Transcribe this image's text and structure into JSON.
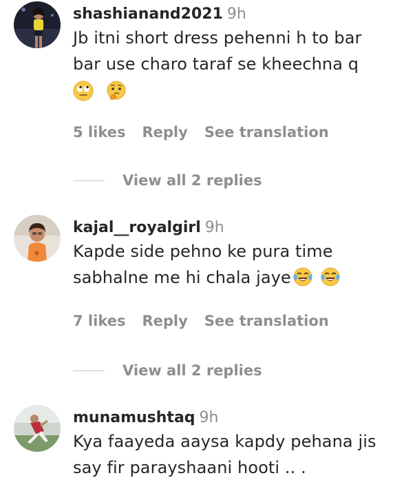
{
  "comments": [
    {
      "username": "shashianand2021",
      "time": "9h",
      "text_lines": [
        "Jb itni short dress pehenni h to bar",
        "bar use charo taraf se kheechna q"
      ],
      "emojis": [
        "face-with-rolling-eyes",
        "thinking-face"
      ],
      "likes": "5 likes",
      "reply": "Reply",
      "translate": "See translation",
      "view_replies": "View all 2 replies"
    },
    {
      "username": "kajal__royalgirl",
      "time": "9h",
      "text_lines": [
        "Kapde side pehno ke pura time",
        "sabhalne me hi chala jaye"
      ],
      "emojis": [
        "face-with-tears-of-joy",
        "face-with-tears-of-joy"
      ],
      "likes": "7 likes",
      "reply": "Reply",
      "translate": "See translation",
      "view_replies": "View all 2 replies"
    },
    {
      "username": "munamushtaq",
      "time": "9h",
      "text_lines": [
        "Kya faayeda aaysa kapdy pehana jis",
        "say fir parayshaani hooti .. ."
      ]
    }
  ]
}
